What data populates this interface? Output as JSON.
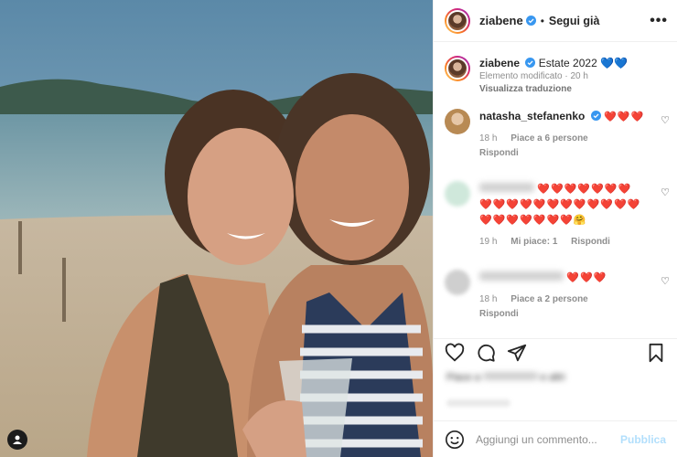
{
  "post": {
    "username": "ziabene",
    "follow_label": "Segui già",
    "more_icon": "more-horizontal-icon"
  },
  "caption": {
    "username": "ziabene",
    "text": "Estate 2022",
    "emoji": "💙💙",
    "edited": "Elemento modificato",
    "age": "20 h",
    "translate": "Visualizza traduzione"
  },
  "comments": [
    {
      "username": "natasha_stefanenko",
      "text": "❤️❤️❤️",
      "age": "18 h",
      "likes": "Piace a 6 persone",
      "reply": "Rispondi"
    },
    {
      "username": "",
      "text": "❤️❤️❤️❤️❤️❤️❤️❤️❤️❤️❤️❤️❤️❤️❤️❤️❤️❤️❤️❤️❤️❤️❤️❤️❤️❤️🤗",
      "age": "19 h",
      "likes": "Mi piace: 1",
      "reply": "Rispondi"
    },
    {
      "username": "",
      "text": "❤️❤️❤️",
      "age": "18 h",
      "likes": "Piace a 2 persone",
      "reply": "Rispondi"
    }
  ],
  "likes_line": "Piace a",
  "likes_names": "e altri",
  "add_comment": {
    "placeholder": "Aggiungi un commento...",
    "publish": "Pubblica"
  },
  "colors": {
    "link_blue": "#b2dffc",
    "heart_red": "#ed4956",
    "verified_blue": "#3897f0"
  }
}
